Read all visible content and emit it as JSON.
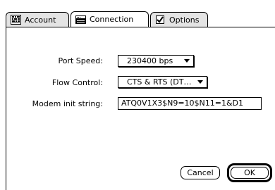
{
  "tabs": [
    {
      "label": "Account",
      "icon": "account-icon",
      "active": false
    },
    {
      "label": "Connection",
      "icon": "modem-icon",
      "active": true
    },
    {
      "label": "Options",
      "icon": "checkbox-icon",
      "active": false
    }
  ],
  "form": {
    "port_speed_label": "Port Speed:",
    "port_speed_value": "230400 bps",
    "flow_control_label": "Flow Control:",
    "flow_control_value": "CTS & RTS (DT…",
    "modem_init_label": "Modem init string:",
    "modem_init_value": "ATQ0V1X3$N9=10$N11=1&D1"
  },
  "buttons": {
    "cancel_label": "Cancel",
    "ok_label": "OK"
  }
}
